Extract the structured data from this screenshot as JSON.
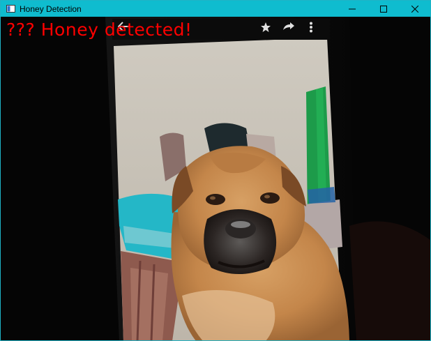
{
  "window": {
    "title": "Honey Detection",
    "icon": "app-window-icon",
    "controls": [
      "minimize-icon",
      "maximize-icon",
      "close-icon"
    ]
  },
  "overlay": {
    "label": "??? Honey detected!",
    "color": "#ff0000"
  },
  "phone_statusbar_icons": [
    "back-arrow-icon",
    "star-icon",
    "share-icon",
    "more-vert-icon"
  ],
  "colors": {
    "titlebar": "#0fbccf",
    "label": "#ff0000"
  }
}
